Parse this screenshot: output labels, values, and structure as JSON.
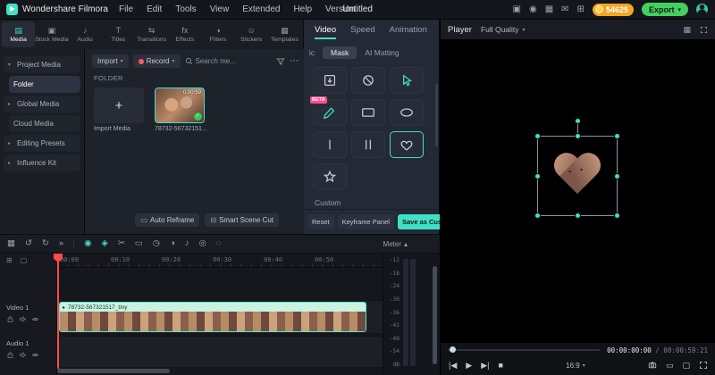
{
  "colors": {
    "accent": "#3fe0c5",
    "export_green": "#46cf5f",
    "coin_orange": "#f5a623",
    "playhead_red": "#ff4a4d",
    "record_red": "#ff5b5b",
    "beta_pink": "#ff4e8b",
    "clip_teal": "#6fd9bd"
  },
  "glyphs": {
    "dropdown": "▾",
    "collapse": "▴",
    "more": "⋯",
    "plus": "+",
    "check": "✓",
    "undo": "↺",
    "redo": "↻",
    "chevrons": "»",
    "layout": "▦",
    "gift": "▣",
    "bell": "◉",
    "mail": "✉",
    "grid": "⊞",
    "play": "▶",
    "stop": "■",
    "prev": "|◀",
    "next": "▶|",
    "tool1": "◉",
    "tool2": "◈",
    "tool3": "✂",
    "tool4": "▭",
    "tool5": "◷",
    "tool6": "◑",
    "tool7": "♪",
    "tool8": "◎",
    "tool9": "◌",
    "corner1": "⊞",
    "corner2": "▢",
    "monitor": "▢",
    "pan": "▭",
    "reframe": "▭",
    "scenecut": "⊟",
    "filmstrip": "▸",
    "multiview": "▦"
  },
  "titlebar": {
    "app_name": "Wondershare Filmora",
    "menus": [
      "File",
      "Edit",
      "Tools",
      "View",
      "Extended",
      "Help",
      "Version"
    ],
    "project_title": "Untitled",
    "coin_count": "54625",
    "export_label": "Export"
  },
  "ribbon": {
    "active_tab": "Media",
    "tabs": [
      {
        "label": "Media",
        "icon": "▤"
      },
      {
        "label": "Stock Media",
        "icon": "▣"
      },
      {
        "label": "Audio",
        "icon": "♪"
      },
      {
        "label": "Titles",
        "icon": "T"
      },
      {
        "label": "Transitions",
        "icon": "⇆"
      },
      {
        "label": "Effects",
        "icon": "fx"
      },
      {
        "label": "Filters",
        "icon": "◑"
      },
      {
        "label": "Stickers",
        "icon": "☺"
      },
      {
        "label": "Templates",
        "icon": "▦"
      }
    ]
  },
  "sidebar": {
    "selected": "Folder",
    "items": [
      {
        "label": "Project Media",
        "arrow": "▾"
      },
      {
        "label": "Folder",
        "arrow": ""
      },
      {
        "label": "Global Media",
        "arrow": "▸"
      },
      {
        "label": "Cloud Media",
        "arrow": ""
      },
      {
        "label": "Editing Presets",
        "arrow": "▸"
      },
      {
        "label": "Influence Kit",
        "arrow": "▸"
      }
    ]
  },
  "media_panel": {
    "import_button": "Import",
    "record_button": "Record",
    "search_placeholder": "Search me...",
    "folder_label": "FOLDER",
    "import_tile": "Import Media",
    "clip_name": "78732-56732151...",
    "clip_duration": "0:00:59",
    "auto_reframe": "Auto Reframe",
    "smart_scene_cut": "Smart Scene Cut"
  },
  "properties": {
    "tabs": [
      "Video",
      "Speed",
      "Animation"
    ],
    "active_tab": "Video",
    "subtab_clipped": "ic",
    "subtab_mask": "Mask",
    "subtab_ai": "AI Matting",
    "beta_label": "BETA",
    "custom_label": "Custom",
    "reset_button": "Reset",
    "keyframe_button": "Keyframe Panel",
    "save_button": "Save as Custom",
    "mask_shapes": [
      "import",
      "none",
      "ai-select",
      "draw-pencil",
      "rectangle",
      "ellipse",
      "single-line",
      "parallel-lines",
      "heart",
      "star"
    ],
    "selected_mask": "heart"
  },
  "player": {
    "label": "Player",
    "quality": "Full Quality",
    "timecode_current": "00:00:00:00",
    "timecode_sep": " / ",
    "timecode_total": "00:00:59:21",
    "aspect_ratio": "16:9"
  },
  "timeline": {
    "ruler_labels": [
      "00:00",
      "00:10",
      "00:20",
      "00:30",
      "00:40",
      "00:50"
    ],
    "clip_label": "78732-567321517_tiny",
    "tracks": [
      {
        "name": "Video 1"
      },
      {
        "name": "Audio 1"
      }
    ],
    "meter": {
      "label": "Meter",
      "ticks": [
        "-12",
        "-18",
        "-24",
        "-30",
        "-36",
        "-42",
        "-48",
        "-54",
        "dB"
      ]
    }
  }
}
